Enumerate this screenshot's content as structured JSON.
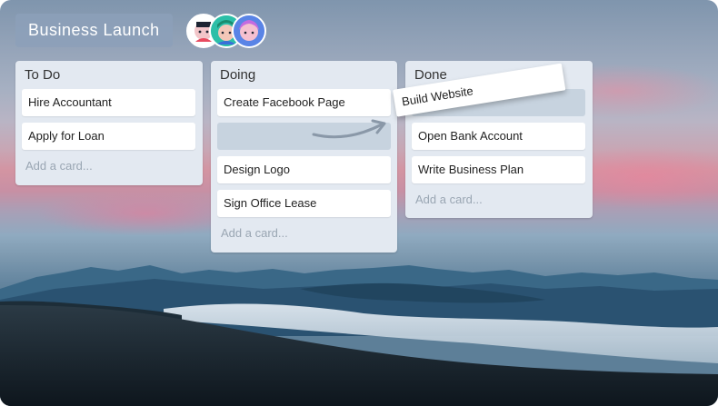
{
  "board": {
    "title": "Business Launch"
  },
  "members": [
    {
      "name": "member-1-avatar",
      "color": "#ffffff"
    },
    {
      "name": "member-2-avatar",
      "color": "#2cbfa8"
    },
    {
      "name": "member-3-avatar",
      "color": "#5a84e6"
    }
  ],
  "lists": [
    {
      "title": "To Do",
      "cards": [
        "Hire Accountant",
        "Apply for Loan"
      ],
      "add_label": "Add a card..."
    },
    {
      "title": "Doing",
      "cards": [
        "Create Facebook Page",
        "Design Logo",
        "Sign Office Lease"
      ],
      "add_label": "Add a card..."
    },
    {
      "title": "Done",
      "cards": [
        "Open Bank Account",
        "Write Business Plan"
      ],
      "add_label": "Add a card..."
    }
  ],
  "dragging": {
    "label": "Build Website"
  },
  "colors": {
    "list_bg": "#e3e9f1",
    "placeholder": "#c7d3df",
    "title_bg": "#8ca0b9"
  }
}
